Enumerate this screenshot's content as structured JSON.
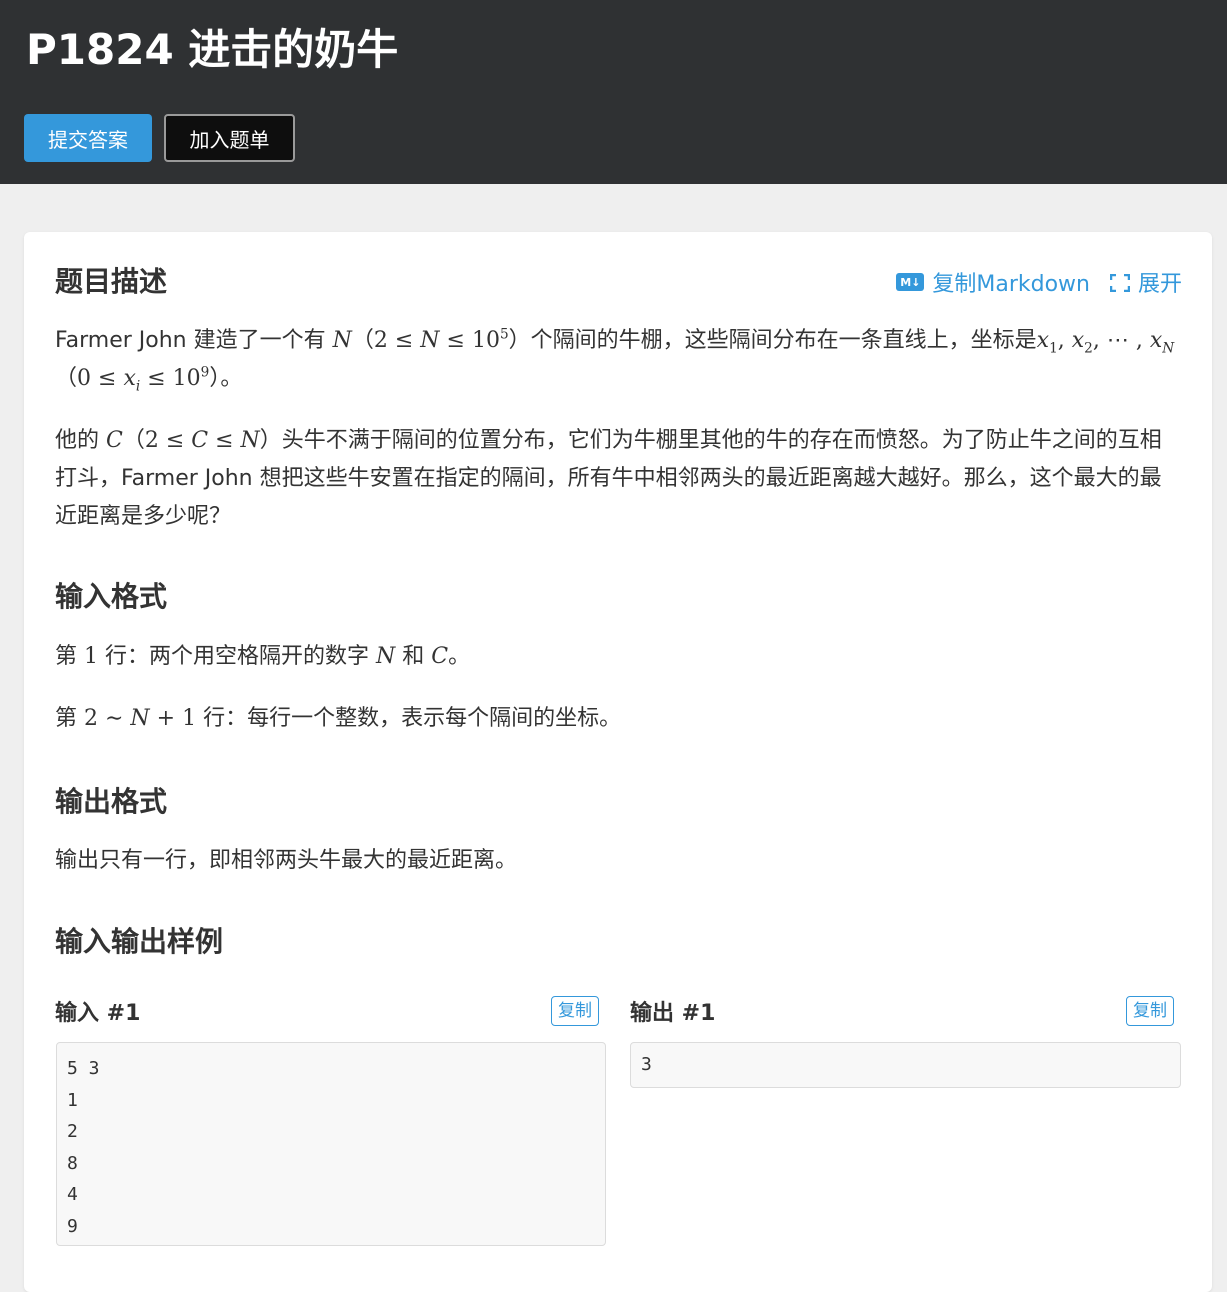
{
  "header": {
    "title": "P1824 进击的奶牛",
    "submit_label": "提交答案",
    "add_list_label": "加入题单"
  },
  "toolbar": {
    "copy_markdown_label": "复制Markdown",
    "markdown_icon_text": "M↓",
    "expand_label": "展开"
  },
  "description": {
    "title": "题目描述",
    "p1": {
      "t1": "Farmer John 建造了一个有 ",
      "N": "N",
      "t2": "（",
      "c1": "2 ≤ ",
      "c2": "N",
      "c3": " ≤ 10",
      "exp": "5",
      "t3": "）个隔间的牛棚，这些隔间分布在一条直线上，坐标是",
      "x": "x",
      "s1": "1",
      "comma1": ", ",
      "x2": "x",
      "s2": "2",
      "dots": ", ⋯ , ",
      "xN": "x",
      "sN": "N",
      "t4": "（",
      "c4": "0 ≤ ",
      "xi": "x",
      "si": "i",
      "c5": " ≤ 10",
      "exp2": "9",
      "t5": "）。"
    },
    "p2": {
      "t1": "他的 ",
      "C": "C",
      "t2": "（",
      "c1": "2 ≤ ",
      "c2": "C",
      "c3": " ≤ ",
      "c4": "N",
      "t3": "）头牛不满于隔间的位置分布，它们为牛棚里其他的牛的存在而愤怒。为了防止牛之间的互相打斗，Farmer John 想把这些牛安置在指定的隔间，所有牛中相邻两头的最近距离越大越好。那么，这个最大的最近距离是多少呢？"
    }
  },
  "input_format": {
    "title": "输入格式",
    "line1": {
      "t1": "第 ",
      "n": "1",
      "t2": " 行：两个用空格隔开的数字 ",
      "N": "N",
      "t3": " 和 ",
      "C": "C",
      "t4": "。"
    },
    "line2": {
      "t1": "第 ",
      "a": "2 ∼ ",
      "N": "N",
      "b": " + 1",
      "t2": " 行：每行一个整数，表示每个隔间的坐标。"
    }
  },
  "output_format": {
    "title": "输出格式",
    "text": "输出只有一行，即相邻两头牛最大的最近距离。"
  },
  "samples": {
    "title": "输入输出样例",
    "input_label": "输入 #1",
    "output_label": "输出 #1",
    "copy_label": "复制",
    "input_lines": [
      "5 3",
      "1",
      "2",
      "8",
      "4",
      "9"
    ],
    "output_lines": [
      "3"
    ]
  },
  "colors": {
    "header_bg": "#2f3133",
    "accent": "#3498db",
    "page_bg": "#efefef"
  }
}
